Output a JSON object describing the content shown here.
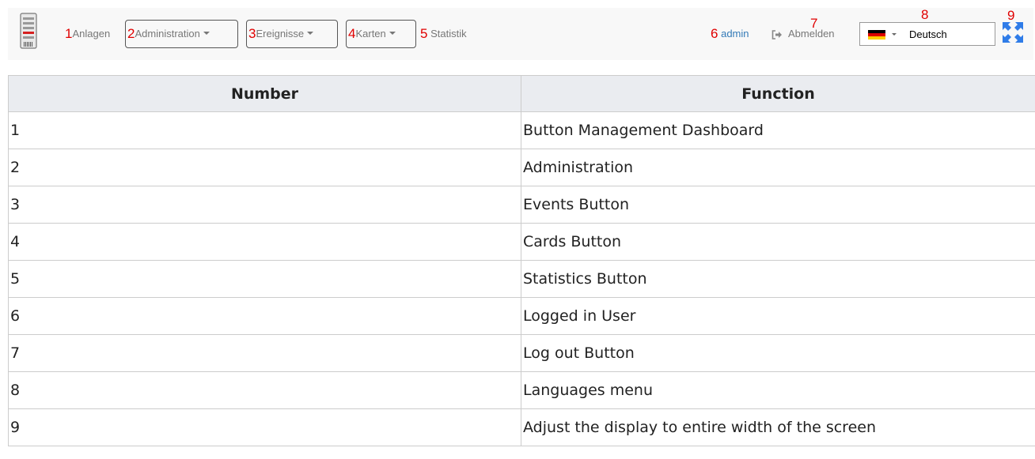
{
  "navbar": {
    "markers": [
      "1",
      "2",
      "3",
      "4",
      "5",
      "6",
      "7",
      "8",
      "9"
    ],
    "anlagen": "Anlagen",
    "administration": "Administration",
    "ereignisse": "Ereignisse",
    "karten": "Karten",
    "statistik": "Statistik",
    "user": "admin",
    "logout": "Abmelden",
    "language": "Deutsch",
    "icons": {
      "logo": "building-logo-icon",
      "logout": "sign-out-icon",
      "flag": "germany-flag-icon",
      "expand": "expand-arrows-icon"
    },
    "colors": {
      "marker": "#e00000",
      "link": "#337ab7",
      "expand": "#2f7ce8"
    }
  },
  "table": {
    "headers": [
      "Number",
      "Function"
    ],
    "rows": [
      [
        "1",
        "Button Management Dashboard"
      ],
      [
        "2",
        "Administration"
      ],
      [
        "3",
        "Events Button"
      ],
      [
        "4",
        "Cards Button"
      ],
      [
        "5",
        "Statistics Button"
      ],
      [
        "6",
        "Logged in User"
      ],
      [
        "7",
        "Log out Button"
      ],
      [
        "8",
        "Languages menu"
      ],
      [
        "9",
        "Adjust the display to entire width of the screen"
      ]
    ]
  }
}
